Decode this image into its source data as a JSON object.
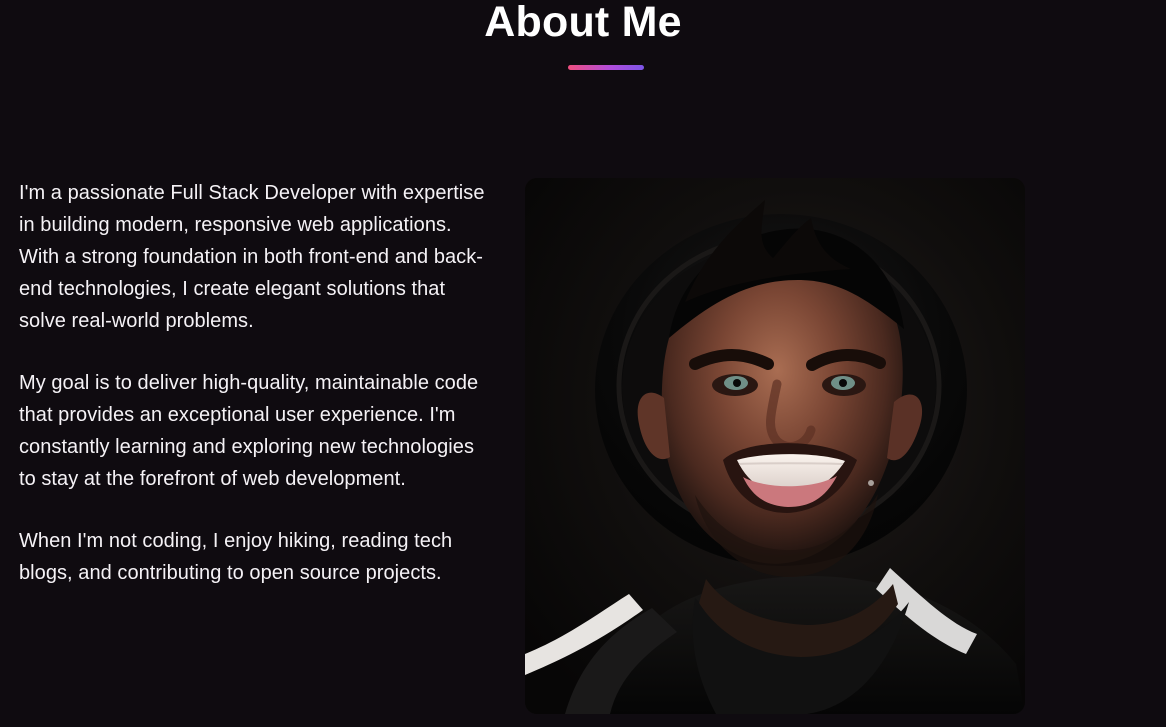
{
  "about": {
    "title": "About Me",
    "paragraphs": [
      "I'm a passionate Full Stack Developer with expertise in building modern, responsive web applications. With a strong foundation in both front-end and back-end technologies, I create elegant solutions that solve real-world problems.",
      "My goal is to deliver high-quality, maintainable code that provides an exceptional user experience. I'm constantly learning and exploring new technologies to stay at the forefront of web development.",
      "When I'm not coding, I enjoy hiking, reading tech blogs, and contributing to open source projects."
    ]
  },
  "colors": {
    "background": "#0f0b10",
    "text": "#f5f2f6",
    "accent_start": "#ef4f7f",
    "accent_end": "#7c55e7"
  },
  "icons": {
    "underline": "gradient-underline"
  }
}
